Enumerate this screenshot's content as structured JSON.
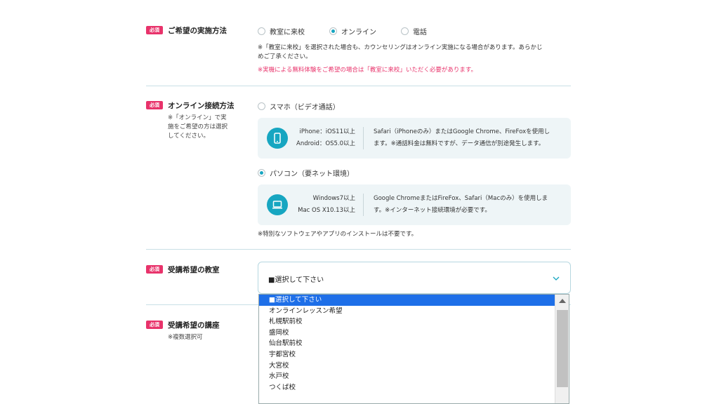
{
  "sections": {
    "method": {
      "badge": "必須",
      "label": "ご希望の実施方法",
      "options": [
        "教室に来校",
        "オンライン",
        "電話"
      ],
      "selected": "オンライン",
      "note1": "※「教室に来校」を選択された場合も、カウンセリングはオンライン実施になる場合があります。あらかじ",
      "note2": "めご了承ください。",
      "note_red": "※実機による無料体験をご希望の場合は「教室に来校」いただく必要があります。"
    },
    "online": {
      "badge": "必須",
      "label": "オンライン接続方法",
      "sub1": "※「オンライン」で実",
      "sub2": "施をご希望の方は選択",
      "sub3": "してください。",
      "smartphone": {
        "option": "スマホ（ビデオ通話）",
        "req1": "iPhone：iOS11以上",
        "req2": "Android：OS5.0以上",
        "desc1": "Safari（iPhoneのみ）またはGoogle Chrome、FireFoxを使用し",
        "desc2": "ます。※通話料金は無料ですが、データ通信が別途発生します。",
        "icon": "smartphone-icon"
      },
      "pc": {
        "option": "パソコン（要ネット環境）",
        "req1": "Windows7以上",
        "req2": "Mac OS X10.13以上",
        "desc1": "Google ChromeまたはFireFox、Safari（Macのみ）を使用しま",
        "desc2": "す。※インターネット接続環境が必要です。",
        "icon": "laptop-icon"
      },
      "selected": "パソコン（要ネット環境）",
      "note": "※特別なソフトウェアやアプリのインストールは不要です。"
    },
    "classroom": {
      "badge": "必須",
      "label": "受講希望の教室",
      "select_value": "■選択して下さい",
      "options": [
        "■選択して下さい",
        "オンラインレッスン希望",
        "札幌駅前校",
        "盛岡校",
        "仙台駅前校",
        "宇都宮校",
        "大宮校",
        "水戸校",
        "つくば校"
      ]
    },
    "course": {
      "badge": "必須",
      "label": "受講希望の講座",
      "sub": "※複数選択可"
    }
  },
  "colors": {
    "accent": "#17a6c1",
    "badge": "#e8336b",
    "highlight": "#1e6fe8"
  }
}
